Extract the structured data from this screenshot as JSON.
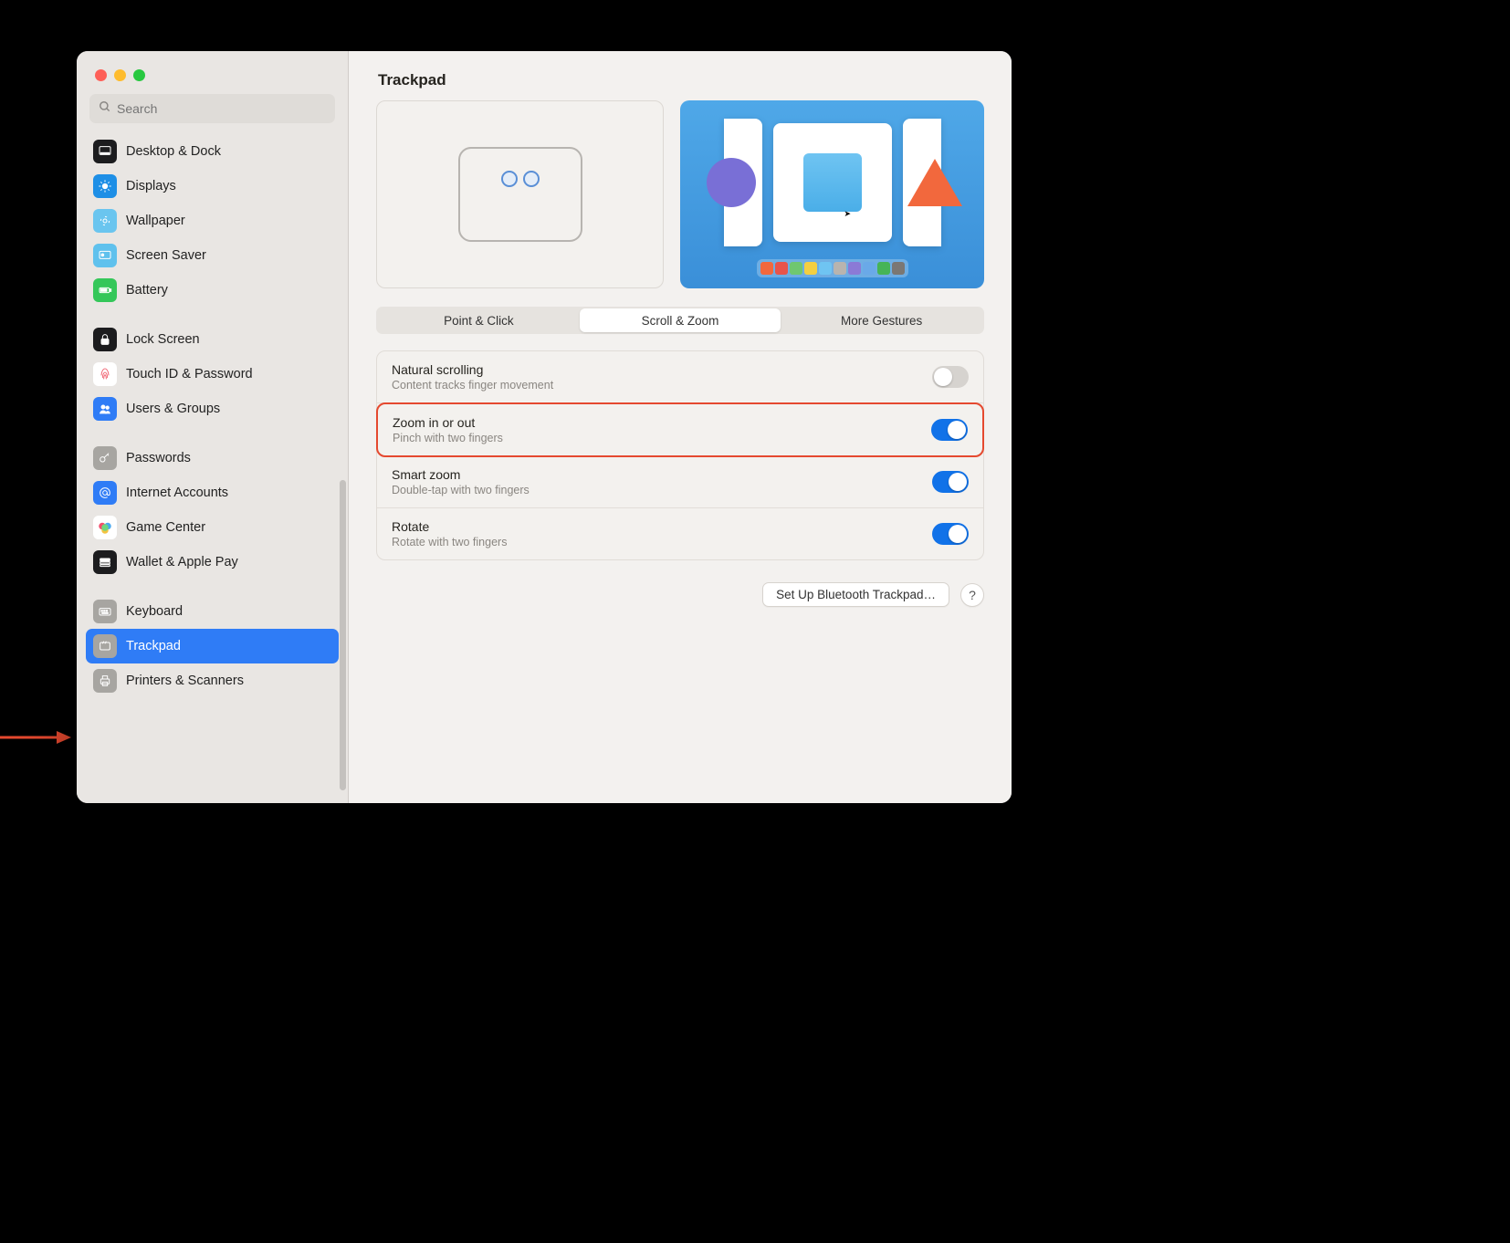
{
  "window": {
    "title": "Trackpad"
  },
  "search": {
    "placeholder": "Search"
  },
  "sidebar": {
    "groups": [
      [
        {
          "label": "Desktop & Dock",
          "icon": "desktop-dock-icon",
          "bg": "#1c1c1e",
          "fg": "#fff"
        },
        {
          "label": "Displays",
          "icon": "displays-icon",
          "bg": "#1e8fe6",
          "fg": "#fff"
        },
        {
          "label": "Wallpaper",
          "icon": "wallpaper-icon",
          "bg": "#6ac5ef",
          "fg": "#fff"
        },
        {
          "label": "Screen Saver",
          "icon": "screensaver-icon",
          "bg": "#5fc1ed",
          "fg": "#fff"
        },
        {
          "label": "Battery",
          "icon": "battery-icon",
          "bg": "#34c759",
          "fg": "#fff"
        }
      ],
      [
        {
          "label": "Lock Screen",
          "icon": "lock-icon",
          "bg": "#1c1c1e",
          "fg": "#fff"
        },
        {
          "label": "Touch ID & Password",
          "icon": "touchid-icon",
          "bg": "#fff",
          "fg": "#ee4e5e"
        },
        {
          "label": "Users & Groups",
          "icon": "users-icon",
          "bg": "#2f7cf6",
          "fg": "#fff"
        }
      ],
      [
        {
          "label": "Passwords",
          "icon": "key-icon",
          "bg": "#a7a5a1",
          "fg": "#fff"
        },
        {
          "label": "Internet Accounts",
          "icon": "at-icon",
          "bg": "#2f7cf6",
          "fg": "#fff"
        },
        {
          "label": "Game Center",
          "icon": "gamecenter-icon",
          "bg": "#fff",
          "fg": "#000"
        },
        {
          "label": "Wallet & Apple Pay",
          "icon": "wallet-icon",
          "bg": "#1c1c1e",
          "fg": "#fff"
        }
      ],
      [
        {
          "label": "Keyboard",
          "icon": "keyboard-icon",
          "bg": "#a7a5a1",
          "fg": "#fff"
        },
        {
          "label": "Trackpad",
          "icon": "trackpad-icon",
          "bg": "#a7a5a1",
          "fg": "#fff",
          "selected": true
        },
        {
          "label": "Printers & Scanners",
          "icon": "printer-icon",
          "bg": "#a7a5a1",
          "fg": "#fff"
        }
      ]
    ]
  },
  "tabs": [
    {
      "label": "Point & Click"
    },
    {
      "label": "Scroll & Zoom",
      "active": true
    },
    {
      "label": "More Gestures"
    }
  ],
  "settings": [
    {
      "title": "Natural scrolling",
      "subtitle": "Content tracks finger movement",
      "on": false
    },
    {
      "title": "Zoom in or out",
      "subtitle": "Pinch with two fingers",
      "on": true,
      "highlighted": true
    },
    {
      "title": "Smart zoom",
      "subtitle": "Double-tap with two fingers",
      "on": true
    },
    {
      "title": "Rotate",
      "subtitle": "Rotate with two fingers",
      "on": true
    }
  ],
  "footer": {
    "setup_button": "Set Up Bluetooth Trackpad…",
    "help": "?"
  },
  "dock_colors": [
    "#f2683d",
    "#e8544b",
    "#6fc770",
    "#f4cf41",
    "#6fc4f2",
    "#b8b4af",
    "#8b7ad6",
    "#6aa9e8",
    "#46b456",
    "#7b7773"
  ]
}
